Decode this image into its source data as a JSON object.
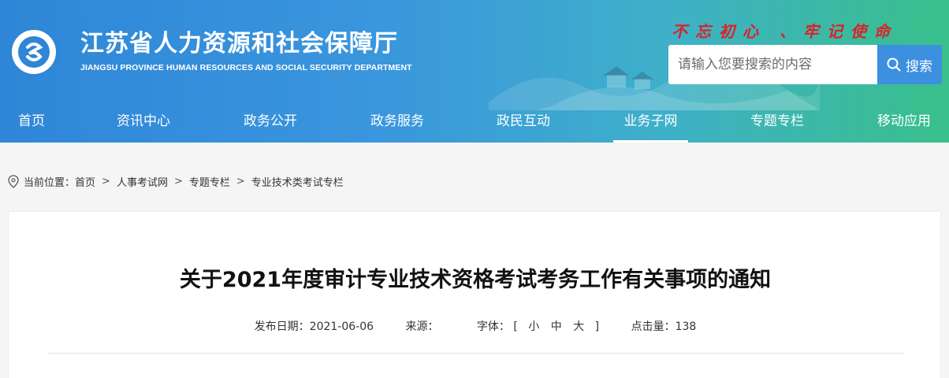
{
  "header": {
    "title": "江苏省人力资源和社会保障厅",
    "subtitle": "JIANGSU PROVINCE HUMAN RESOURCES AND SOCIAL SECURITY DEPARTMENT",
    "slogan": "不忘初心 、牢记使命",
    "logo_text": "江苏省人力资源和社会保障厅"
  },
  "search": {
    "placeholder": "请输入您要搜索的内容",
    "button_label": "搜索"
  },
  "nav": {
    "items": [
      {
        "label": "首页"
      },
      {
        "label": "资讯中心"
      },
      {
        "label": "政务公开"
      },
      {
        "label": "政务服务"
      },
      {
        "label": "政民互动"
      },
      {
        "label": "业务子网"
      },
      {
        "label": "专题专栏"
      },
      {
        "label": "移动应用"
      }
    ],
    "active": "业务子网"
  },
  "breadcrumb": {
    "prefix": "当前位置：",
    "items": [
      "首页",
      "人事考试网",
      "专题专栏",
      "专业技术类考试专栏"
    ],
    "separator": ">"
  },
  "article": {
    "title": "关于2021年度审计专业技术资格考试考务工作有关事项的通知",
    "date_label": "发布日期：",
    "date": "2021-06-06",
    "source_label": "来源：",
    "source": "",
    "font_label": "字体：",
    "font_open": "[",
    "font_small": "小",
    "font_medium": "中",
    "font_large": "大",
    "font_close": "]",
    "clicks_label": "点击量：",
    "clicks": "138"
  },
  "colors": {
    "header_start": "#2f86d8",
    "header_end": "#39c08a",
    "slogan": "#d8232a",
    "search_button": "#3d8fe0"
  }
}
